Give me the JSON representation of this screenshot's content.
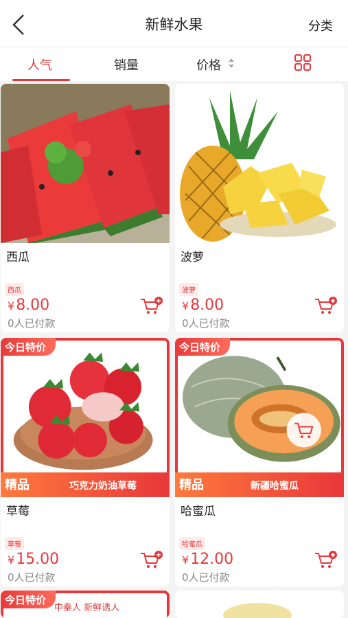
{
  "header": {
    "title": "新鲜水果",
    "category": "分类"
  },
  "tabs": [
    {
      "label": "人气"
    },
    {
      "label": "销量"
    },
    {
      "label": "价格"
    }
  ],
  "products": [
    {
      "name": "西瓜",
      "tag": "西瓜",
      "price": "8.00",
      "paid": "0人已付款"
    },
    {
      "name": "波萝",
      "tag": "波萝",
      "price": "8.00",
      "paid": "0人已付款"
    },
    {
      "name": "草莓",
      "tag": "草莓",
      "price": "15.00",
      "paid": "0人已付款",
      "badge": "今日特价",
      "jing": "精品",
      "slogan": "巧克力奶油草莓"
    },
    {
      "name": "哈蜜瓜",
      "tag": "哈蜜瓜",
      "price": "12.00",
      "paid": "0人已付款",
      "badge": "今日特价",
      "jing": "精品",
      "slogan": "新疆哈蜜瓜"
    }
  ],
  "partial": {
    "badge": "今日特价",
    "text": "中秦人 新鲜诱人"
  },
  "currency": "¥",
  "colors": {
    "accent": "#e8373a"
  }
}
